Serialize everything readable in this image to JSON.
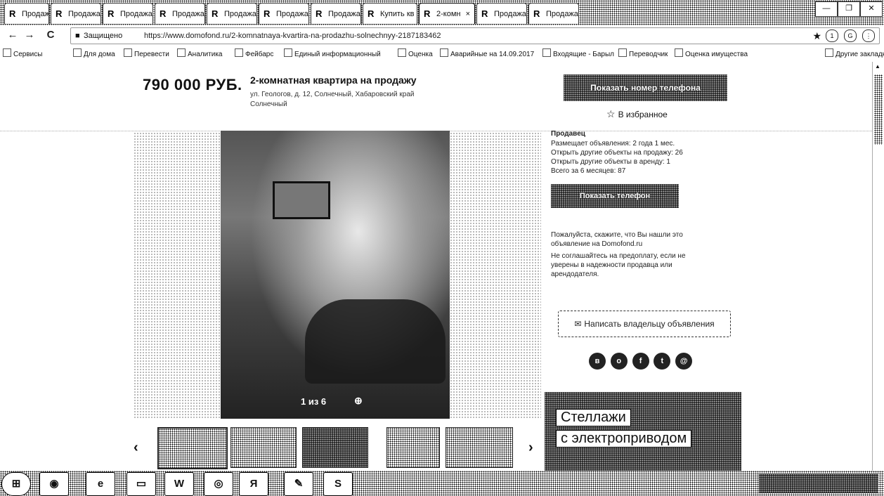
{
  "tabs": [
    {
      "label": "Продажа"
    },
    {
      "label": "Продажа"
    },
    {
      "label": "Продажа"
    },
    {
      "label": "Продажа"
    },
    {
      "label": "Продажа"
    },
    {
      "label": "Продажа"
    },
    {
      "label": "Продажа"
    },
    {
      "label": "Купить кв"
    },
    {
      "label": "2-комн"
    },
    {
      "label": "Продажа"
    },
    {
      "label": "Продажа"
    }
  ],
  "tab_close": "×",
  "window_controls": {
    "minimize": "—",
    "maximize": "❐",
    "close": "✕"
  },
  "nav": {
    "back": "←",
    "forward": "→",
    "reload": "C"
  },
  "address_bar": {
    "secure_label": "Защищено",
    "url": "https://www.domofond.ru/2-komnatnaya-kvartira-na-prodazhu-solnechnyy-2187183462"
  },
  "bookmarks": [
    {
      "label": "Сервисы"
    },
    {
      "label": "Для дома"
    },
    {
      "label": "Перевести"
    },
    {
      "label": "Аналитика"
    },
    {
      "label": "Фейбарс"
    },
    {
      "label": "Единый информационный"
    },
    {
      "label": "Оценка"
    },
    {
      "label": "Аварийные на 14.09.2017"
    },
    {
      "label": "Входящие - Барыл"
    },
    {
      "label": "Переводчик"
    },
    {
      "label": "Оценка имущества"
    },
    {
      "label": "Другие закладки"
    }
  ],
  "listing": {
    "price": "790 000 РУБ.",
    "title": "2-комнатная квартира на продажу",
    "address_line1": "ул. Геологов, д. 12, Солнечный, Хабаровский край",
    "address_line2": "Солнечный",
    "call_button": "Показать номер телефона",
    "favorite": "В избранное",
    "photo_counter": "1 из 6",
    "prev": "‹",
    "next": "›"
  },
  "sidebar": {
    "seller_label": "Продавец",
    "posted": "Размещает объявления: 2 года 1 мес.",
    "others_sale": "Открыть другие объекты на продажу: 26",
    "others_rent": "Открыть другие объекты в аренду: 1",
    "views": "Всего за 6 месяцев: 87",
    "show_phone": "Показать телефон",
    "note1": "Пожалуйста, скажите, что Вы нашли это объявление на Domofond.ru",
    "note2": "Не соглашайтесь на предоплату, если не уверены в надежности продавца или арендодателя.",
    "write_owner": "Написать владельцу объявления",
    "social": [
      "vk",
      "ok",
      "fb",
      "tw",
      "mail"
    ]
  },
  "ad": {
    "line1": "Стеллажи",
    "line2": "с электроприводом"
  },
  "taskbar": {
    "items": [
      "start",
      "chrome",
      "ie",
      "explorer",
      "word",
      "media",
      "yandex",
      "paint",
      "skype"
    ],
    "yandex_label": "Я",
    "skype_label": "S"
  }
}
